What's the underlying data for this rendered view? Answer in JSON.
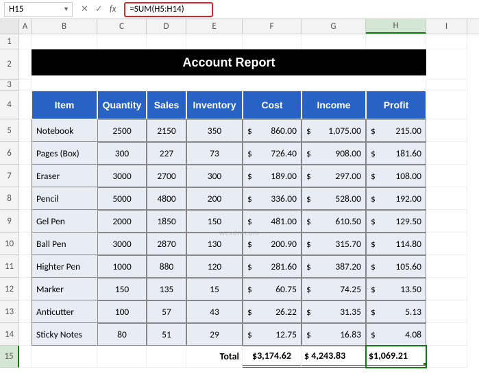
{
  "nameBox": "H15",
  "formula": "=SUM(H5:H14)",
  "cols": [
    "A",
    "B",
    "C",
    "D",
    "E",
    "F",
    "G",
    "H",
    "I"
  ],
  "rowNums": [
    "1",
    "2",
    "3",
    "4",
    "5",
    "6",
    "7",
    "8",
    "9",
    "10",
    "11",
    "12",
    "13",
    "14",
    "15"
  ],
  "title": "Account Report",
  "headers": [
    "Item",
    "Quantity",
    "Sales",
    "Inventory",
    "Cost",
    "Income",
    "Profit"
  ],
  "rows": [
    {
      "item": "Notebook",
      "qty": "2500",
      "sales": "2150",
      "inv": "350",
      "cost": "860.00",
      "income": "1,075.00",
      "profit": "215.00"
    },
    {
      "item": "Pages (Box)",
      "qty": "300",
      "sales": "227",
      "inv": "73",
      "cost": "726.40",
      "income": "908.00",
      "profit": "181.60"
    },
    {
      "item": "Eraser",
      "qty": "3000",
      "sales": "2700",
      "inv": "300",
      "cost": "189.00",
      "income": "297.00",
      "profit": "108.00"
    },
    {
      "item": "Pencil",
      "qty": "5000",
      "sales": "4800",
      "inv": "200",
      "cost": "336.00",
      "income": "528.00",
      "profit": "192.00"
    },
    {
      "item": "Gel Pen",
      "qty": "2000",
      "sales": "1850",
      "inv": "150",
      "cost": "481.00",
      "income": "610.50",
      "profit": "129.50"
    },
    {
      "item": "Ball Pen",
      "qty": "3000",
      "sales": "2870",
      "inv": "130",
      "cost": "200.90",
      "income": "315.70",
      "profit": "114.80"
    },
    {
      "item": "Highter Pen",
      "qty": "1000",
      "sales": "880",
      "inv": "120",
      "cost": "281.60",
      "income": "387.20",
      "profit": "105.60"
    },
    {
      "item": "Marker",
      "qty": "150",
      "sales": "135",
      "inv": "15",
      "cost": "60.75",
      "income": "74.25",
      "profit": "13.50"
    },
    {
      "item": "Anticutter",
      "qty": "100",
      "sales": "57",
      "inv": "43",
      "cost": "26.22",
      "income": "31.35",
      "profit": "5.13"
    },
    {
      "item": "Sticky Notes",
      "qty": "80",
      "sales": "51",
      "inv": "29",
      "cost": "12.75",
      "income": "16.83",
      "profit": "4.08"
    }
  ],
  "totals": {
    "label": "Total",
    "cost": "$3,174.62",
    "income": "$ 4,243.83",
    "profit": "$1,069.21"
  },
  "chart_data": {
    "type": "table",
    "title": "Account Report",
    "columns": [
      "Item",
      "Quantity",
      "Sales",
      "Inventory",
      "Cost",
      "Income",
      "Profit"
    ],
    "data": [
      [
        "Notebook",
        2500,
        2150,
        350,
        860.0,
        1075.0,
        215.0
      ],
      [
        "Pages (Box)",
        300,
        227,
        73,
        726.4,
        908.0,
        181.6
      ],
      [
        "Eraser",
        3000,
        2700,
        300,
        189.0,
        297.0,
        108.0
      ],
      [
        "Pencil",
        5000,
        4800,
        200,
        336.0,
        528.0,
        192.0
      ],
      [
        "Gel Pen",
        2000,
        1850,
        150,
        481.0,
        610.5,
        129.5
      ],
      [
        "Ball Pen",
        3000,
        2870,
        130,
        200.9,
        315.7,
        114.8
      ],
      [
        "Highter Pen",
        1000,
        880,
        120,
        281.6,
        387.2,
        105.6
      ],
      [
        "Marker",
        150,
        135,
        15,
        60.75,
        74.25,
        13.5
      ],
      [
        "Anticutter",
        100,
        57,
        43,
        26.22,
        31.35,
        5.13
      ],
      [
        "Sticky Notes",
        80,
        51,
        29,
        12.75,
        16.83,
        4.08
      ]
    ],
    "totals": {
      "Cost": 3174.62,
      "Income": 4243.83,
      "Profit": 1069.21
    }
  },
  "watermark": "wcxdn.com"
}
